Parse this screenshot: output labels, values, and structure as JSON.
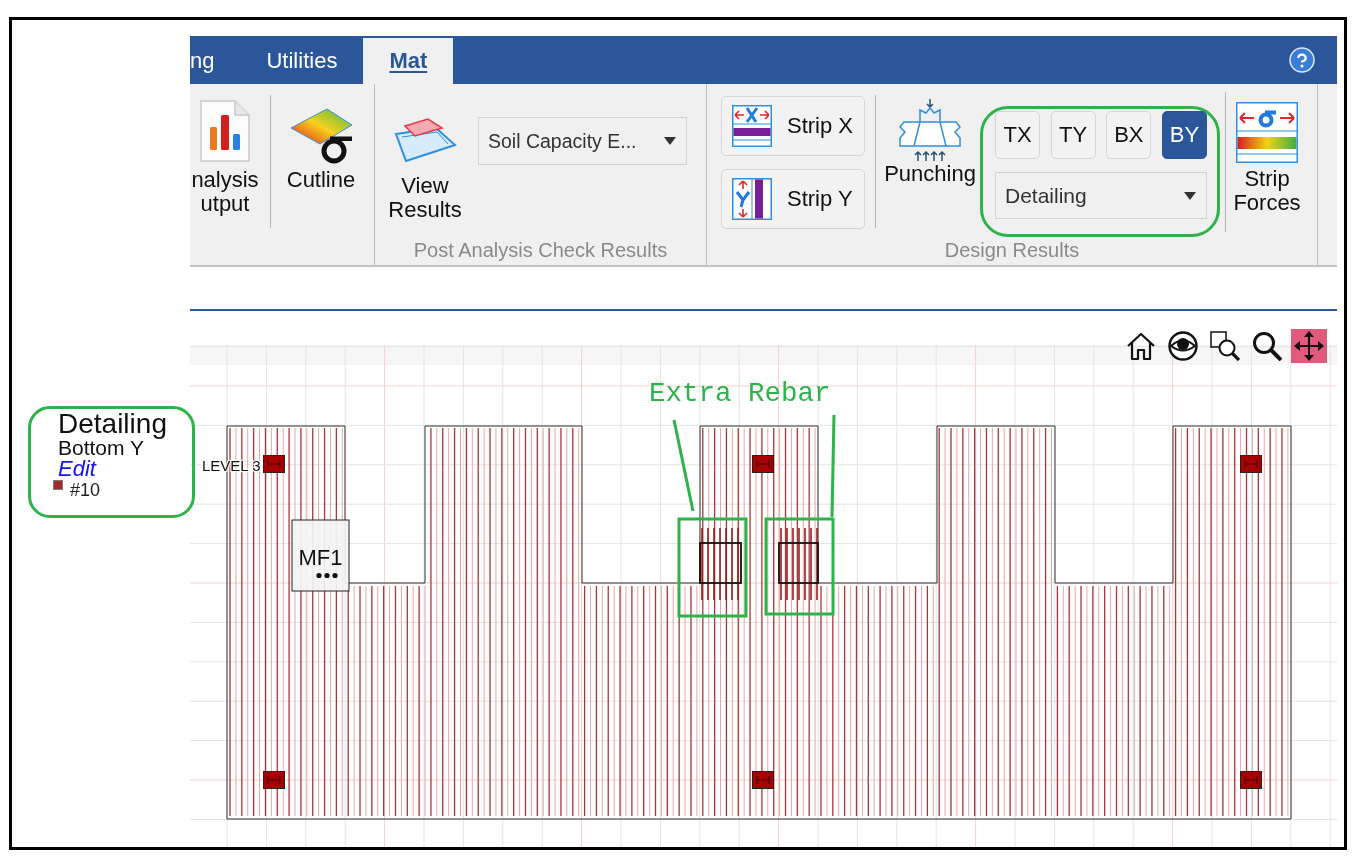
{
  "tabs": [
    {
      "label": "ng",
      "selected": false
    },
    {
      "label": "Utilities",
      "selected": false
    },
    {
      "label": "Mat",
      "selected": true
    }
  ],
  "output_group": {
    "analysis_output": {
      "label_lines": [
        "nalysis",
        "utput"
      ]
    },
    "cutline": {
      "label_lines": [
        "Cutline"
      ]
    }
  },
  "post_analysis_group": {
    "title": "Post Analysis Check Results",
    "view_results": {
      "label_lines": [
        "View",
        "Results"
      ]
    },
    "result_type": {
      "value": "Soil Capacity E..."
    }
  },
  "design_results_group": {
    "title": "Design Results",
    "strips": [
      {
        "kind": "x",
        "label": "Strip X"
      },
      {
        "kind": "y",
        "label": "Strip Y"
      }
    ],
    "punching": {
      "label_lines": [
        "Punching"
      ]
    },
    "layers": [
      {
        "label": "TX",
        "selected": false
      },
      {
        "label": "TY",
        "selected": false
      },
      {
        "label": "BX",
        "selected": false
      },
      {
        "label": "BY",
        "selected": true
      }
    ],
    "layer_result": {
      "value": "Detailing"
    },
    "strip_forces": {
      "label_lines": [
        "Strip",
        "Forces"
      ]
    }
  },
  "view_tools": [
    {
      "kind": "home",
      "selected": false
    },
    {
      "kind": "view",
      "selected": false
    },
    {
      "kind": "zoom_window",
      "selected": false
    },
    {
      "kind": "zoom",
      "selected": false
    },
    {
      "kind": "pan",
      "selected": true
    }
  ],
  "legend": {
    "title": "Detailing",
    "subtitle": "Bottom Y",
    "edit_link": "Edit",
    "entries": [
      {
        "label": "#10",
        "color": "#a32a2a"
      }
    ]
  },
  "plan": {
    "level_label": "LEVEL 3",
    "mat_tag": "MF1"
  },
  "annotation": {
    "label": "Extra Rebar"
  }
}
